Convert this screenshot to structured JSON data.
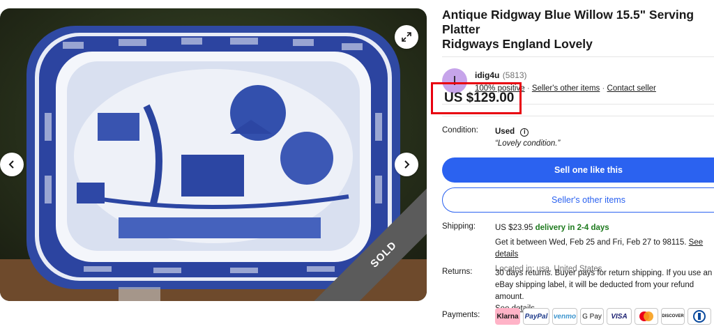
{
  "gallery": {
    "prev_icon": "chevron-left-icon",
    "next_icon": "chevron-right-icon",
    "expand_icon": "expand-icon",
    "sold_label": "SOLD"
  },
  "item": {
    "title_line1": "Antique Ridgway Blue Willow 15.5\" Serving Platter",
    "title_line2": "Ridgways England Lovely",
    "price": "US $129.00"
  },
  "seller": {
    "avatar_letter": "I",
    "name": "idig4u",
    "feedback_count": "(5813)",
    "positive": "100% positive",
    "other_items": "Seller's other items",
    "contact": "Contact seller",
    "sep": "·"
  },
  "condition": {
    "label": "Condition:",
    "value": "Used",
    "note": "“Lovely condition.”"
  },
  "buttons": {
    "sell_like": "Sell one like this",
    "other_items": "Seller's other items"
  },
  "shipping": {
    "label": "Shipping:",
    "cost": "US $23.95",
    "speed": "delivery in 2-4 days",
    "estimate": "Get it between Wed, Feb 25 and Fri, Feb 27 to 98115.",
    "details_link": "See details",
    "location": "Located in: usa, United States"
  },
  "returns": {
    "label": "Returns:",
    "text": "30 days returns. Buyer pays for return shipping. If you use an eBay shipping label, it will be deducted from your refund amount.",
    "details_link": "See details"
  },
  "payments": {
    "label": "Payments:",
    "methods": [
      "Klarna",
      "PayPal",
      "venmo",
      "G Pay",
      "VISA",
      "Mastercard",
      "DISCOVER",
      "Diners"
    ]
  },
  "colors": {
    "accent_blue": "#2b62f0",
    "highlight_red": "#e8000f",
    "avatar_purple": "#c6a4ea",
    "green": "#1e7a1e"
  }
}
